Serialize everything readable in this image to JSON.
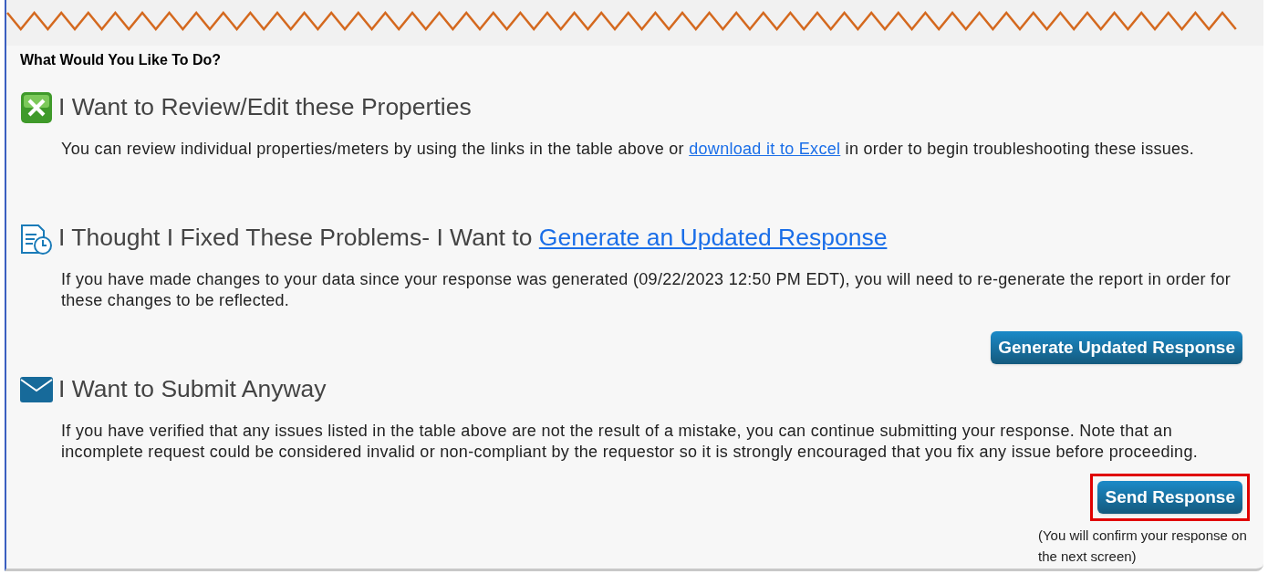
{
  "heading": "What Would You Like To Do?",
  "sections": [
    {
      "kind": "spreadsheet",
      "title": "I Want to Review/Edit these Properties",
      "text_before": "You can review individual properties/meters by using the links in the table above or ",
      "link": "download it to Excel",
      "text_after": " in order to begin troubleshooting these issues."
    },
    {
      "kind": "report",
      "title": "I Thought I Fixed These Problems- I Want to ",
      "title_link": "Generate an Updated Response",
      "text_before": "If you have made changes to your data since your response was generated (09/22/2023 12:50 PM EDT), you will need to re-generate the report in order for these changes to be reflected.",
      "button": {
        "label": "Generate Updated Response",
        "highlighted": false
      }
    },
    {
      "kind": "envelope",
      "title": "I Want to Submit Anyway",
      "text_before": "If you have verified that any issues listed in the table above are not the result of a mistake, you can continue submitting your response. Note that an incomplete request could be considered invalid or non-compliant by the requestor so it is strongly encouraged that you fix any issue before proceeding.",
      "button": {
        "label": "Send Response",
        "highlighted": true
      },
      "note": "(You will confirm your response on the next screen)"
    }
  ]
}
